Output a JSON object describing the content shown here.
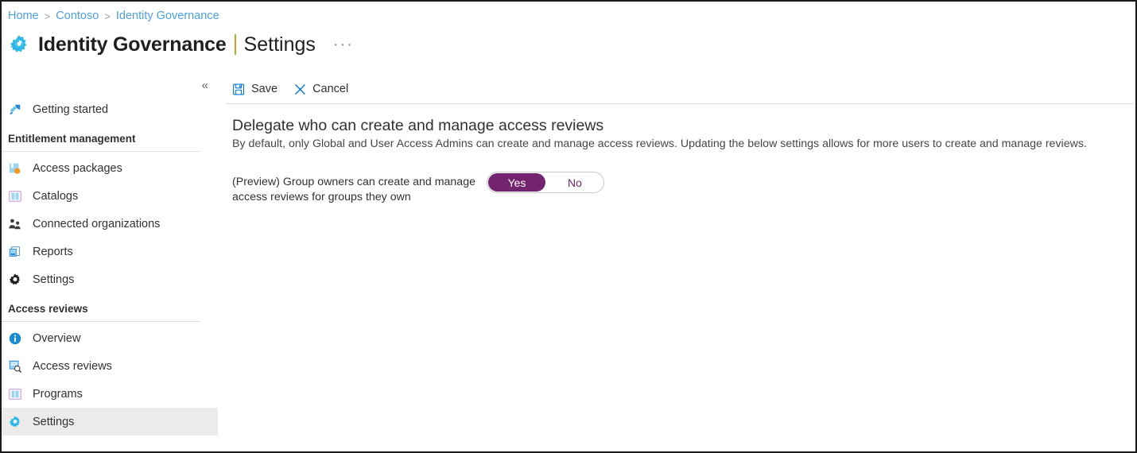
{
  "breadcrumb": {
    "items": [
      "Home",
      "Contoso",
      "Identity Governance"
    ],
    "separator": ">"
  },
  "header": {
    "icon": "gear-icon",
    "title": "Identity Governance",
    "separator": "|",
    "subtitle": "Settings",
    "more_label": "···"
  },
  "sidebar": {
    "collapse_label": "«",
    "top_items": [
      {
        "label": "Getting started",
        "icon": "rocket-icon",
        "selected": false
      }
    ],
    "sections": [
      {
        "title": "Entitlement management",
        "items": [
          {
            "label": "Access packages",
            "icon": "package-icon",
            "selected": false
          },
          {
            "label": "Catalogs",
            "icon": "catalog-book-icon",
            "selected": false
          },
          {
            "label": "Connected organizations",
            "icon": "people-icon",
            "selected": false
          },
          {
            "label": "Reports",
            "icon": "reports-icon",
            "selected": false
          },
          {
            "label": "Settings",
            "icon": "gear-dark-icon",
            "selected": false
          }
        ]
      },
      {
        "title": "Access reviews",
        "items": [
          {
            "label": "Overview",
            "icon": "info-icon",
            "selected": false
          },
          {
            "label": "Access reviews",
            "icon": "review-search-icon",
            "selected": false
          },
          {
            "label": "Programs",
            "icon": "programs-book-icon",
            "selected": false
          },
          {
            "label": "Settings",
            "icon": "gear-blue-icon",
            "selected": true
          }
        ]
      }
    ]
  },
  "toolbar": {
    "save_label": "Save",
    "save_icon": "save-disk-icon",
    "cancel_label": "Cancel",
    "cancel_icon": "close-x-icon"
  },
  "main": {
    "heading": "Delegate who can create and manage access reviews",
    "description": "By default, only Global and User Access Admins can create and manage access reviews. Updating the below settings allows for more users to create and manage reviews.",
    "setting": {
      "label": "(Preview) Group owners can create and manage access reviews for groups they own",
      "toggle": {
        "on_label": "Yes",
        "off_label": "No",
        "value": "Yes"
      }
    }
  },
  "colors": {
    "accent_blue": "#0078d4",
    "link_blue": "#4a9fe0",
    "toggle_purple": "#73246e",
    "selected_row": "#edebe9",
    "text_primary": "#323130"
  }
}
